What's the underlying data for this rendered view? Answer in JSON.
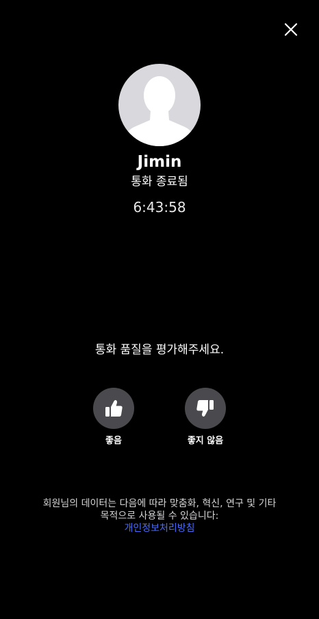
{
  "colors": {
    "background": "#000000",
    "text": "#ffffff",
    "button_circle": "#4a4a4e",
    "avatar_bg": "#d8d8dd",
    "avatar_silhouette": "#ffffff",
    "link": "#4a6cf7"
  },
  "header": {
    "close_icon": "close-icon"
  },
  "caller": {
    "avatar_icon": "default-person-avatar",
    "name": "Jimin",
    "status": "통화 종료됨",
    "duration": "6:43:58"
  },
  "rating": {
    "prompt": "통화 품질을 평가해주세요.",
    "options": [
      {
        "label": "좋음",
        "icon": "thumbs-up-icon"
      },
      {
        "label": "좋지 않음",
        "icon": "thumbs-down-icon"
      }
    ]
  },
  "notice": {
    "line1": "회원님의 데이터는 다음에 따라 맞춤화, 혁신, 연구 및 기타",
    "line2": "목적으로 사용될 수 있습니다:",
    "link_text": "개인정보처리방침"
  }
}
